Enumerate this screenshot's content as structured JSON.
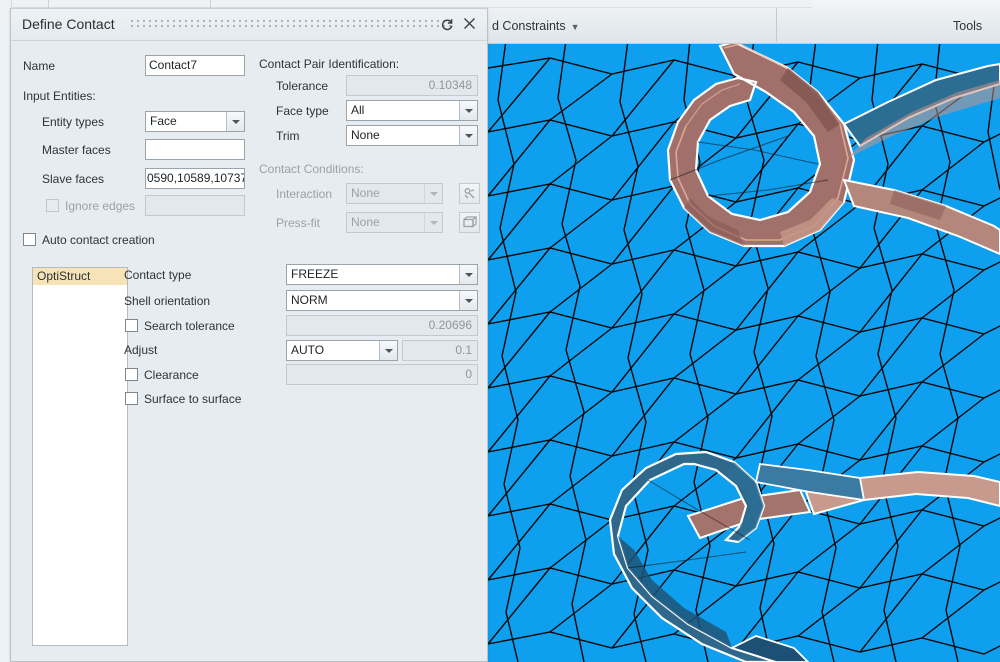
{
  "ribbon": {
    "groups": [
      {
        "label": "d Constraints",
        "caret": "▼",
        "has_caret": true
      },
      {
        "label": "Tools",
        "caret": "",
        "has_caret": false
      }
    ]
  },
  "dialog": {
    "title": "Define Contact",
    "buttons": {
      "reset": {
        "name": "reset-icon",
        "tooltip": "Reset"
      },
      "close": {
        "name": "close-icon",
        "tooltip": "Close"
      }
    },
    "name_label": "Name",
    "name_value": "Contact7",
    "input_entities_label": "Input Entities:",
    "entity_types_label": "Entity types",
    "entity_types_value": "Face",
    "master_faces_label": "Master faces",
    "master_faces_value": "",
    "slave_faces_label": "Slave faces",
    "slave_faces_value": "0590,10589,10737",
    "ignore_edges_label": "Ignore edges",
    "ignore_edges_checked": false,
    "ignore_edges_value": "",
    "auto_contact_label": "Auto contact creation",
    "auto_contact_checked": false,
    "contact_pair_label": "Contact Pair Identification:",
    "tolerance_label": "Tolerance",
    "tolerance_value": "0.10348",
    "face_type_label": "Face type",
    "face_type_value": "All",
    "trim_label": "Trim",
    "trim_value": "None",
    "contact_conditions_label": "Contact Conditions:",
    "interaction_label": "Interaction",
    "interaction_value": "None",
    "press_fit_label": "Press-fit",
    "press_fit_value": "None",
    "solver_list": [
      {
        "label": "OptiStruct",
        "selected": true
      }
    ],
    "contact_type_label": "Contact type",
    "contact_type_value": "FREEZE",
    "shell_orientation_label": "Shell orientation",
    "shell_orientation_value": "NORM",
    "search_tolerance_label": "Search tolerance",
    "search_tolerance_checked": false,
    "search_tolerance_value": "0.20696",
    "adjust_label": "Adjust",
    "adjust_value": "AUTO",
    "adjust_number": "0.1",
    "clearance_label": "Clearance",
    "clearance_checked": false,
    "clearance_value": "0",
    "surface_to_surface_label": "Surface to surface",
    "surface_to_surface_checked": false
  },
  "viewport": {
    "mesh_color": "#0e9fee",
    "edge_color": "#0a0a0a",
    "highlight_brown": "#9c6a62",
    "highlight_brown_light": "#c08f84",
    "highlight_blue_dark": "#1d5f86",
    "highlight_white": "#ffffff"
  }
}
